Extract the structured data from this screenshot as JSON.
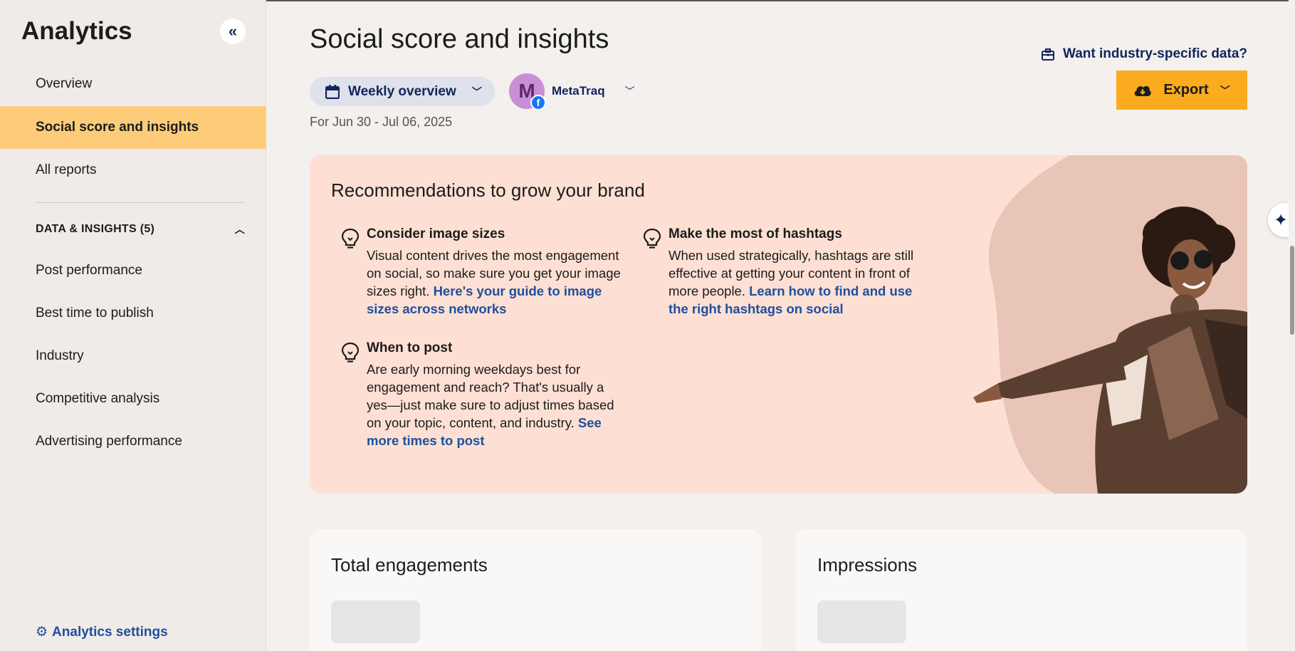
{
  "sidebar": {
    "title": "Analytics",
    "collapse_icon": "chevrons-left-icon",
    "items": [
      {
        "label": "Overview"
      },
      {
        "label": "Social score and insights",
        "active": true
      },
      {
        "label": "All reports"
      }
    ],
    "section_label": "DATA & INSIGHTS (5)",
    "section_items": [
      {
        "label": "Post performance"
      },
      {
        "label": "Best time to publish"
      },
      {
        "label": "Industry"
      },
      {
        "label": "Competitive analysis"
      },
      {
        "label": "Advertising performance"
      }
    ],
    "settings_label": "Analytics settings"
  },
  "header": {
    "title": "Social score and insights",
    "period_label": "Weekly overview",
    "account": {
      "initial": "M",
      "name": "MetaTraq",
      "network_badge": "f"
    },
    "date_range": "For Jun 30 - Jul 06, 2025",
    "industry_link": "Want industry-specific data?",
    "export_label": "Export"
  },
  "recommendations": {
    "title": "Recommendations to grow your brand",
    "tips": [
      {
        "heading": "Consider image sizes",
        "body": "Visual content drives the most engagement on social, so make sure you get your image sizes right. ",
        "link": "Here's your guide to image sizes across networks"
      },
      {
        "heading": "Make the most of hashtags",
        "body": "When used strategically, hashtags are still effective at getting your content in front of more people. ",
        "link": "Learn how to find and use the right hashtags on social"
      },
      {
        "heading": "When to post",
        "body": "Are early morning weekdays best for engagement and reach? That's usually a yes—just make sure to adjust times based on your topic, content, and industry. ",
        "link": "See more times to post"
      }
    ]
  },
  "metrics": [
    {
      "title": "Total engagements"
    },
    {
      "title": "Impressions"
    }
  ],
  "colors": {
    "accent": "#fdcc7a",
    "export": "#fcab1e",
    "link": "#1f4f9e",
    "card": "#fde0d3"
  }
}
